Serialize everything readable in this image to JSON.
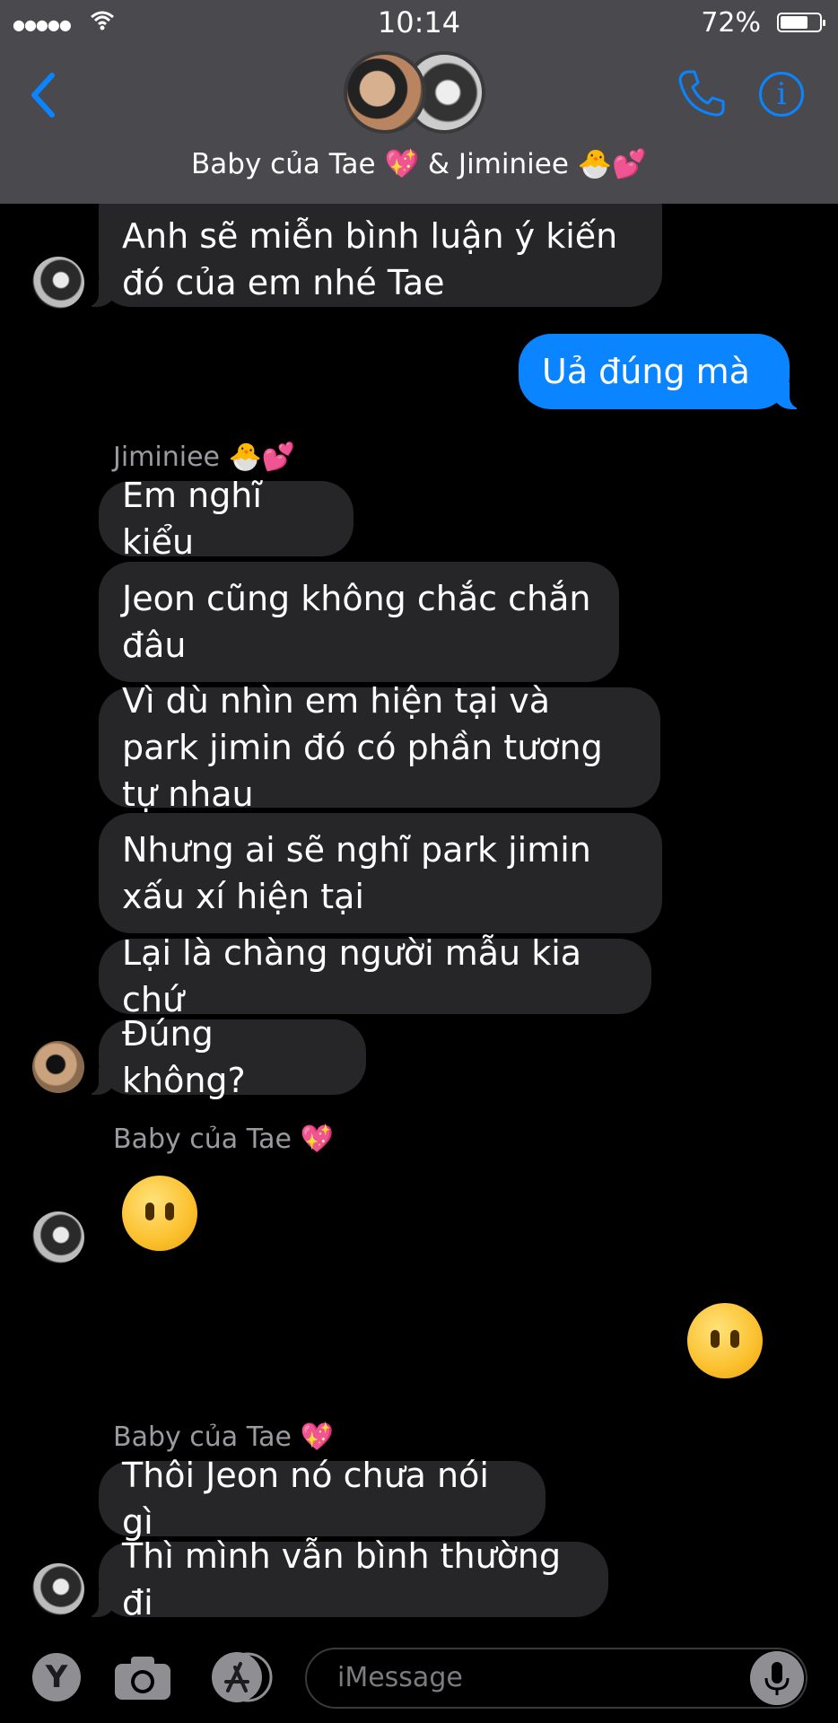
{
  "status_bar": {
    "signal": "●●●●●",
    "time": "10:14",
    "battery_percent": "72%",
    "battery_level": 0.72
  },
  "header": {
    "title": "Baby của Tae 💖 & Jiminiee 🐣💕"
  },
  "messages": [
    {
      "from": "Baby của Tae 💖",
      "text": "Anh sẽ miễn bình luận ý kiến đó của em nhé Tae"
    },
    {
      "from": "me",
      "text": "Uả đúng mà"
    },
    {
      "sender_label": "Jiminiee 🐣💕"
    },
    {
      "from": "Jiminiee 🐣💕",
      "text": "Em nghĩ kiểu"
    },
    {
      "from": "Jiminiee 🐣💕",
      "text": "Jeon cũng không chắc chắn đâu"
    },
    {
      "from": "Jiminiee 🐣💕",
      "text": "Vì dù nhìn em hiện tại và park jimin đó có phần tương tự nhau"
    },
    {
      "from": "Jiminiee 🐣💕",
      "text": "Nhưng ai sẽ nghĩ park jimin xấu xí hiện tại"
    },
    {
      "from": "Jiminiee 🐣💕",
      "text": "Lại là chàng người mẫu kia chứ"
    },
    {
      "from": "Jiminiee 🐣💕",
      "text": "Đúng không?"
    },
    {
      "sender_label": "Baby của Tae 💖"
    },
    {
      "from": "Baby của Tae 💖",
      "emoji": "face-without-mouth"
    },
    {
      "from": "me",
      "emoji": "face-without-mouth"
    },
    {
      "sender_label": "Baby của Tae 💖"
    },
    {
      "from": "Baby của Tae 💖",
      "text": "Thôi Jeon nó chưa nói gì"
    },
    {
      "from": "Baby của Tae 💖",
      "text": "Thì mình vẫn bình thường đi"
    }
  ],
  "input_bar": {
    "app_button": "Y",
    "placeholder": "iMessage"
  },
  "colors": {
    "accent": "#0a84ff",
    "incoming_bubble": "#262628",
    "bar": "#4a4a4e"
  }
}
